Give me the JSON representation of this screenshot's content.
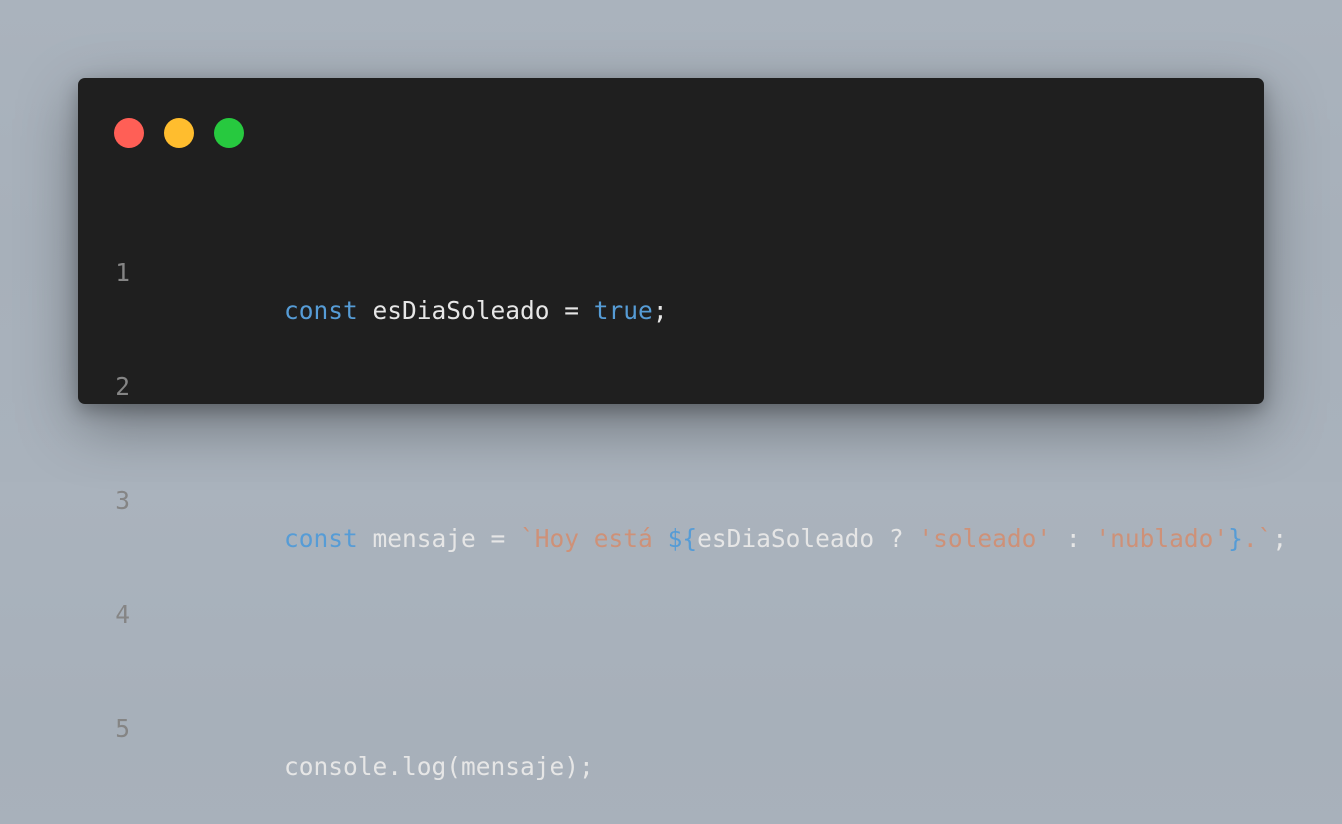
{
  "window": {
    "controls": [
      {
        "name": "close",
        "color": "#ff5f56"
      },
      {
        "name": "minimize",
        "color": "#ffbd2e"
      },
      {
        "name": "maximize",
        "color": "#27c93f"
      }
    ]
  },
  "code": {
    "lines": [
      {
        "number": "1",
        "tokens": [
          {
            "text": "const",
            "kind": "kw"
          },
          {
            "text": " esDiaSoleado = ",
            "kind": "id"
          },
          {
            "text": "true",
            "kind": "kw"
          },
          {
            "text": ";",
            "kind": "id"
          }
        ]
      },
      {
        "number": "2",
        "tokens": []
      },
      {
        "number": "3",
        "tokens": [
          {
            "text": "const",
            "kind": "kw"
          },
          {
            "text": " mensaje = ",
            "kind": "id"
          },
          {
            "text": "`Hoy está ",
            "kind": "str"
          },
          {
            "text": "${",
            "kind": "kw"
          },
          {
            "text": "esDiaSoleado ? ",
            "kind": "id"
          },
          {
            "text": "'soleado'",
            "kind": "str"
          },
          {
            "text": " : ",
            "kind": "id"
          },
          {
            "text": "'nublado'",
            "kind": "str"
          },
          {
            "text": "}",
            "kind": "kw"
          },
          {
            "text": ".`",
            "kind": "str"
          },
          {
            "text": ";",
            "kind": "id"
          }
        ]
      },
      {
        "number": "4",
        "tokens": []
      },
      {
        "number": "5",
        "tokens": [
          {
            "text": "console.log(mensaje);",
            "kind": "id"
          }
        ]
      }
    ]
  }
}
